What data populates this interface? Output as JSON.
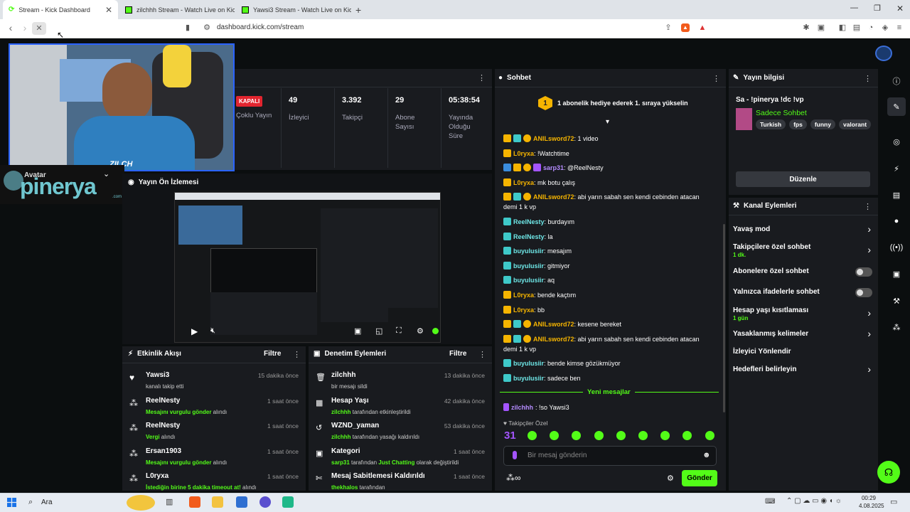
{
  "browser": {
    "tabs": [
      {
        "title": "Stream - Kick Dashboard",
        "active": true
      },
      {
        "title": "zilchhh Stream - Watch Live on Kick"
      },
      {
        "title": "Yawsi3 Stream - Watch Live on Kick"
      }
    ],
    "url": "dashboard.kick.com/stream"
  },
  "webcam": {
    "overlay_name": "ZILCH",
    "logo_text": "pinerya",
    "logo_sub": ".com",
    "avatar_label": "Avatar"
  },
  "stats": [
    {
      "value": "KAPALI",
      "label": "Çoklu Yayın"
    },
    {
      "value": "49",
      "label": "İzleyici"
    },
    {
      "value": "3.392",
      "label": "Takipçi"
    },
    {
      "value": "29",
      "label": "Abone Sayısı"
    },
    {
      "value": "05:38:54",
      "label": "Yayında Olduğu Süre"
    }
  ],
  "preview": {
    "title": "Yayın Ön İzlemesi"
  },
  "activity": {
    "title": "Etkinlik Akışı",
    "filter": "Filtre",
    "items": [
      {
        "user": "Yawsi3",
        "time": "15 dakika önce",
        "pre": "",
        "hl": "",
        "post": "kanalı takip etti"
      },
      {
        "user": "ReelNesty",
        "time": "1 saat önce",
        "pre": "",
        "hl": "Mesajını vurgulu gönder",
        "post": " alındı"
      },
      {
        "user": "ReelNesty",
        "time": "1 saat önce",
        "pre": "",
        "hl": "Vergi",
        "post": " alındı"
      },
      {
        "user": "Ersan1903",
        "time": "1 saat önce",
        "pre": "",
        "hl": "Mesajını vurgulu gönder",
        "post": " alındı"
      },
      {
        "user": "L0ryxa",
        "time": "1 saat önce",
        "pre": "",
        "hl": "İstediğin birine 5 dakika timeout at!",
        "post": " alındı"
      }
    ]
  },
  "moderation": {
    "title": "Denetim Eylemleri",
    "filter": "Filtre",
    "items": [
      {
        "user": "zilchhh",
        "time": "13 dakika önce",
        "hl": "",
        "post": "bir mesajı sildi",
        "hl2": "",
        "post2": ""
      },
      {
        "user": "Hesap Yaşı",
        "time": "42 dakika önce",
        "hl": "zilchhh",
        "post": " tarafından etkinleştirildi",
        "hl2": "",
        "post2": ""
      },
      {
        "user": "WZND_yaman",
        "time": "53 dakika önce",
        "hl": "zilchhh",
        "post": " tarafından yasağı kaldırıldı",
        "hl2": "",
        "post2": ""
      },
      {
        "user": "Kategori",
        "time": "1 saat önce",
        "hl": "sarp31",
        "post": " tarafından ",
        "hl2": "Just Chatting",
        "post2": " olarak değiştirildi"
      },
      {
        "user": "Mesaj Sabitlemesi Kaldırıldı",
        "time": "1 saat önce",
        "hl": "thekhalos",
        "post": " tarafından",
        "hl2": "",
        "post2": ""
      }
    ]
  },
  "chat": {
    "title": "Sohbet",
    "gift_banner": "1 abonelik hediye ederek 1. sıraya yükselin",
    "gift_rank": "1",
    "messages": [
      {
        "user": "ANILsword72",
        "color": "y",
        "text": ": 1 video"
      },
      {
        "user": "L0ryxa",
        "color": "y",
        "text": ": !Watchtime"
      },
      {
        "user": "sarp31",
        "color": "g",
        "text": ": @ReelNesty"
      },
      {
        "user": "L0ryxa",
        "color": "y",
        "text": ": mk botu çalış"
      },
      {
        "user": "ANILsword72",
        "color": "y",
        "text": ": abi yarın sabah sen kendi cebinden atacan",
        "cont": "demi 1 k vp"
      },
      {
        "user": "ReelNesty",
        "color": "t",
        "text": ": burdayım"
      },
      {
        "user": "ReelNesty",
        "color": "t",
        "text": ": la"
      },
      {
        "user": "buyulusiir",
        "color": "t",
        "text": ": mesajım"
      },
      {
        "user": "buyulusiir",
        "color": "t",
        "text": ": gitmiyor"
      },
      {
        "user": "buyulusiir",
        "color": "t",
        "text": ": aq"
      },
      {
        "user": "L0ryxa",
        "color": "y",
        "text": ": bende kaçtım"
      },
      {
        "user": "L0ryxa",
        "color": "y",
        "text": ": bb"
      },
      {
        "user": "ANILsword72",
        "color": "y",
        "text": ": kesene bereket"
      },
      {
        "user": "ANILsword72",
        "color": "y",
        "text": ": abi yarın sabah sen kendi cebinden atacan",
        "cont": "demi 1 k vp"
      },
      {
        "user": "buyulusiir",
        "color": "t",
        "text": ": bende kimse gözükmüyor"
      },
      {
        "user": "buyulusiir",
        "color": "t",
        "text": ": sadece ben"
      }
    ],
    "new_messages": "Yeni mesajlar",
    "new_msg": {
      "user": "zilchhh",
      "text": ": !so Yawsi3"
    },
    "followers_only": "Takipçiler Özel",
    "emote_num": "31",
    "input_placeholder": "Bir mesaj gönderin",
    "send": "Gönder"
  },
  "stream_info": {
    "title": "Yayın bilgisi",
    "stream_title": "Sa - !pinerya !dc !vp",
    "category": "Sadece Sohbet",
    "tags": [
      "Turkish",
      "fps",
      "funny",
      "valorant"
    ],
    "edit": "Düzenle"
  },
  "channel_actions": {
    "title": "Kanal Eylemleri",
    "items": [
      {
        "label": "Yavaş mod",
        "sub": "",
        "kind": "chev"
      },
      {
        "label": "Takipçilere özel sohbet",
        "sub": "1 dk.",
        "kind": "chev"
      },
      {
        "label": "Abonelere özel sohbet",
        "sub": "",
        "kind": "toggle"
      },
      {
        "label": "Yalnızca ifadelerle sohbet",
        "sub": "",
        "kind": "toggle"
      },
      {
        "label": "Hesap yaşı kısıtlaması",
        "sub": "1 gün",
        "kind": "chev"
      },
      {
        "label": "Yasaklanmış kelimeler",
        "sub": "",
        "kind": "chev"
      },
      {
        "label": "İzleyici Yönlendir",
        "sub": "",
        "kind": "none"
      },
      {
        "label": "Hedefleri belirleyin",
        "sub": "",
        "kind": "chev"
      }
    ]
  },
  "taskbar": {
    "search": "Ara",
    "time": "00:29",
    "date": "4.08.2025"
  },
  "colors": {
    "accent": "#53fc18",
    "panel": "#191b1f",
    "bg": "#0b0e0f"
  }
}
